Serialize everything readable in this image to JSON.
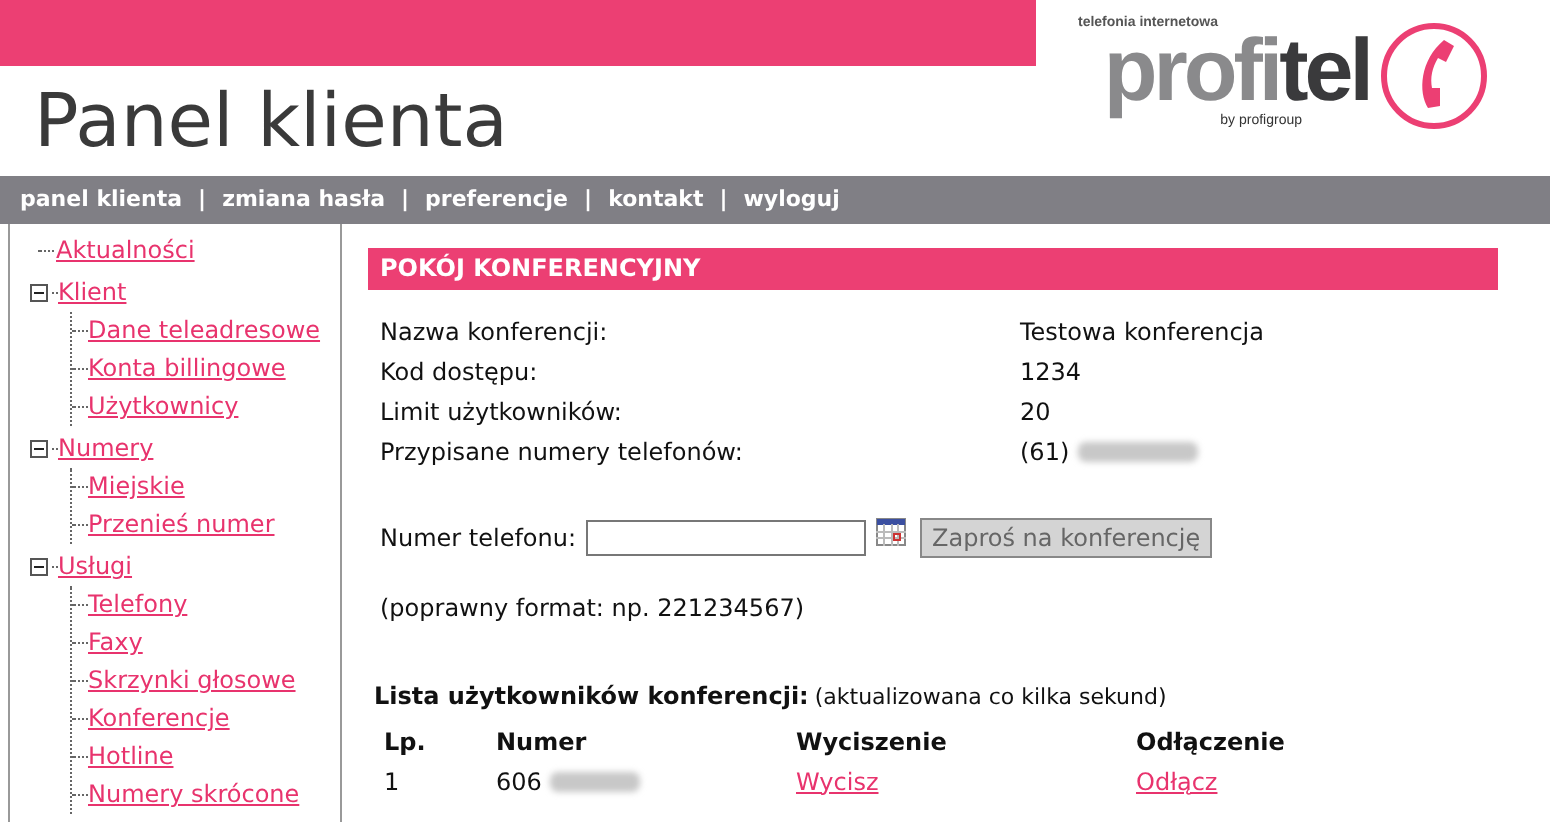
{
  "header": {
    "title": "Panel klienta",
    "logo": {
      "tagline": "telefonia internetowa",
      "brand_light": "profi",
      "brand_dark": "tel",
      "byline": "by profigroup"
    }
  },
  "nav": {
    "items": [
      "panel klienta",
      "zmiana hasła",
      "preferencje",
      "kontakt",
      "wyloguj"
    ],
    "separator": "|"
  },
  "sidebar": {
    "tree": [
      {
        "label": "Aktualności"
      },
      {
        "label": "Klient",
        "expanded": true,
        "children": [
          {
            "label": "Dane teleadresowe"
          },
          {
            "label": "Konta billingowe"
          },
          {
            "label": "Użytkownicy"
          }
        ]
      },
      {
        "label": "Numery",
        "expanded": true,
        "children": [
          {
            "label": "Miejskie"
          },
          {
            "label": "Przenieś numer"
          }
        ]
      },
      {
        "label": "Usługi",
        "expanded": true,
        "children": [
          {
            "label": "Telefony"
          },
          {
            "label": "Faxy"
          },
          {
            "label": "Skrzynki głosowe"
          },
          {
            "label": "Konferencje"
          },
          {
            "label": "Hotline"
          },
          {
            "label": "Numery skrócone"
          }
        ]
      }
    ]
  },
  "section": {
    "title": "POKÓJ KONFERENCYJNY",
    "details": [
      {
        "label": "Nazwa konferencji:",
        "value": "Testowa konferencja",
        "redacted": false
      },
      {
        "label": "Kod dostępu:",
        "value": "1234",
        "redacted": false
      },
      {
        "label": "Limit użytkowników:",
        "value": "20",
        "redacted": false
      },
      {
        "label": "Przypisane numery telefonów:",
        "value": "(61)",
        "redacted": true
      }
    ],
    "form": {
      "label": "Numer telefonu:",
      "button": "Zaproś na konferencję"
    },
    "hint": "(poprawny format: np. 221234567)",
    "users": {
      "title": "Lista użytkowników konferencji:",
      "note": "(aktualizowana co kilka sekund)",
      "columns": [
        "Lp.",
        "Numer",
        "Wyciszenie",
        "Odłączenie"
      ],
      "rows": [
        {
          "lp": "1",
          "number": "606",
          "redacted": true,
          "mute": "Wycisz",
          "disconnect": "Odłącz"
        }
      ]
    }
  }
}
